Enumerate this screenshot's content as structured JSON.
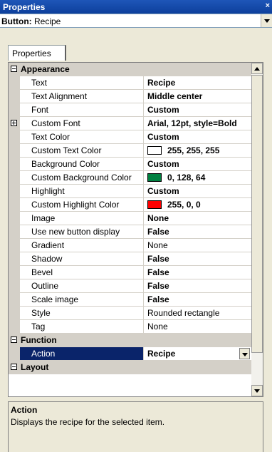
{
  "window": {
    "title": "Properties",
    "close_glyph": "×"
  },
  "object_selector": {
    "type": "Button:",
    "name": "Recipe"
  },
  "tabs": [
    {
      "label": "Properties"
    }
  ],
  "grid": {
    "categories": {
      "appearance": "Appearance",
      "function": "Function",
      "layout": "Layout"
    },
    "appearance_rows": [
      {
        "name": "Text",
        "value": "Recipe",
        "bold": true
      },
      {
        "name": "Text Alignment",
        "value": "Middle center",
        "bold": true
      },
      {
        "name": "Font",
        "value": "Custom",
        "bold": true
      },
      {
        "name": "Custom Font",
        "value": "Arial, 12pt, style=Bold",
        "bold": true,
        "expandable": true
      },
      {
        "name": "Text Color",
        "value": "Custom",
        "bold": true
      },
      {
        "name": "Custom Text Color",
        "value": "255, 255, 255",
        "bold": true,
        "swatch": "#ffffff"
      },
      {
        "name": "Background Color",
        "value": "Custom",
        "bold": true
      },
      {
        "name": "Custom Background Color",
        "value": "0, 128, 64",
        "bold": true,
        "swatch": "#008040"
      },
      {
        "name": "Highlight",
        "value": "Custom",
        "bold": true
      },
      {
        "name": "Custom Highlight Color",
        "value": "255, 0, 0",
        "bold": true,
        "swatch": "#ff0000"
      },
      {
        "name": "Image",
        "value": "None",
        "bold": true
      },
      {
        "name": "Use new button display",
        "value": "False",
        "bold": true
      },
      {
        "name": "Gradient",
        "value": "None",
        "bold": false
      },
      {
        "name": "Shadow",
        "value": "False",
        "bold": true
      },
      {
        "name": "Bevel",
        "value": "False",
        "bold": true
      },
      {
        "name": "Outline",
        "value": "False",
        "bold": true
      },
      {
        "name": "Scale image",
        "value": "False",
        "bold": true
      },
      {
        "name": "Style",
        "value": "Rounded rectangle",
        "bold": false
      },
      {
        "name": "Tag",
        "value": "None",
        "bold": false
      }
    ],
    "function_rows": [
      {
        "name": "Action",
        "value": "Recipe",
        "bold": true,
        "selected": true
      }
    ]
  },
  "help": {
    "title": "Action",
    "description": "Displays the recipe for the selected item."
  },
  "colors": {
    "title_bar": "#0d3f9c",
    "selection": "#0a246a",
    "category_bg": "#d4d0c8"
  }
}
